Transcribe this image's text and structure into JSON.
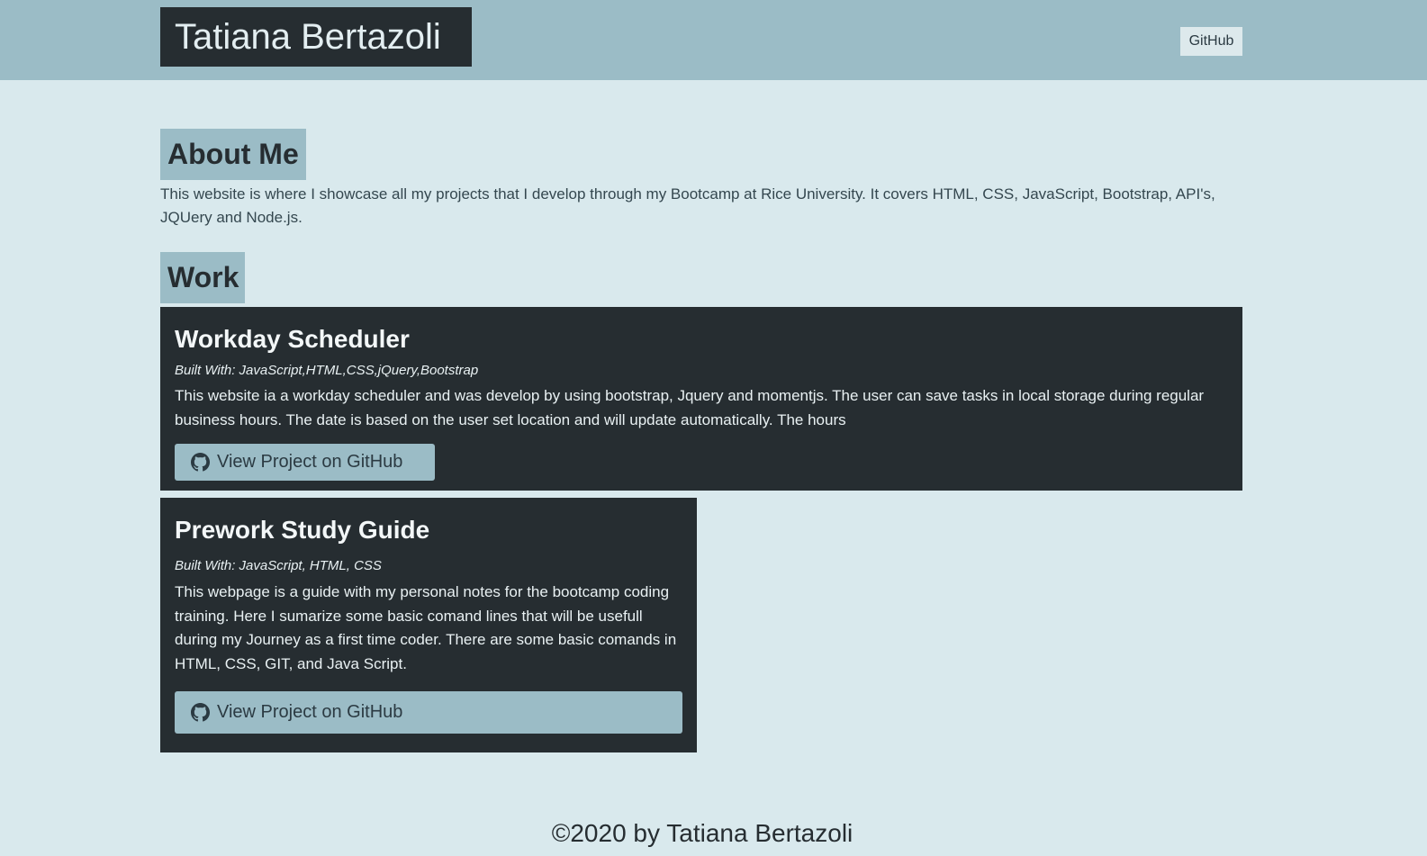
{
  "header": {
    "brand": "Tatiana Bertazoli",
    "nav_github": "GitHub"
  },
  "about": {
    "title": "About Me",
    "text": "This website is where I showcase all my projects that I develop through my Bootcamp at Rice University. It covers HTML, CSS, JavaScript, Bootstrap, API's, JQUery and Node.js."
  },
  "work": {
    "title": "Work",
    "projects": [
      {
        "title": "Workday Scheduler",
        "built_with": "Built With: JavaScript,HTML,CSS,jQuery,Bootstrap",
        "description": "This website ia a workday scheduler and was develop by using bootstrap, Jquery and momentjs. The user can save tasks in local storage during regular business hours. The date is based on the user set location and will update automatically. The hours",
        "button_label": "View Project on GitHub",
        "button_icon": "github-icon"
      },
      {
        "title": "Prework Study Guide",
        "built_with": "Built With: JavaScript, HTML, CSS",
        "description": "This webpage is a guide with my personal notes for the bootcamp coding training. Here I sumarize some basic comand lines that will be usefull during my Journey as a first time coder. There are some basic comands in HTML, CSS, GIT, and Java Script.",
        "button_label": "View Project on GitHub",
        "button_icon": "github-icon"
      }
    ]
  },
  "footer": {
    "text": "©2020 by Tatiana Bertazoli"
  },
  "colors": {
    "page_bg": "#d9e9ed",
    "header_bg": "#9bbcc6",
    "dark": "#262d31",
    "accent": "#9bbcc6"
  }
}
